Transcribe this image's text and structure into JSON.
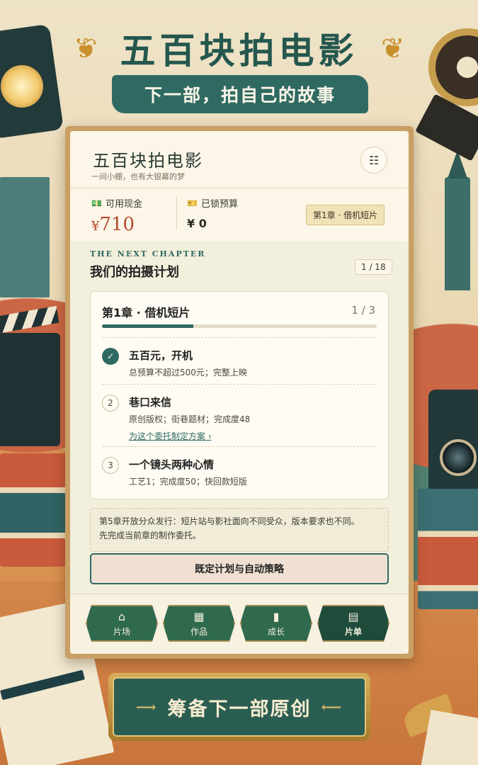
{
  "header": {
    "title": "五百块拍电影",
    "banner": "下一部，拍自己的故事"
  },
  "app": {
    "title": "五百块拍电影",
    "subtitle": "一间小棚，也有大银幕的梦",
    "menu_icon": "grid-menu-icon"
  },
  "stats": {
    "cash_label": "可用现金",
    "cash_currency": "¥",
    "cash_value": "710",
    "locked_label": "已锁预算",
    "locked_value": "¥ 0",
    "chapter_tag": "第1章 · 借机短片"
  },
  "plan": {
    "eyebrow": "THE NEXT CHAPTER",
    "title": "我们的拍摄计划",
    "page_counter": "1 / 18",
    "chapter": {
      "title": "第1章 · 借机短片",
      "progress_text": "1 / 3",
      "progress_fraction": 0.3333
    },
    "tasks": [
      {
        "marker": "✓",
        "status": "done",
        "title": "五百元，开机",
        "desc": "总预算不超过500元；完整上映"
      },
      {
        "marker": "2",
        "status": "todo",
        "title": "巷口来信",
        "desc": "原创版权；街巷题材；完成度48",
        "link": "为这个委托制定方案 ›"
      },
      {
        "marker": "3",
        "status": "todo",
        "title": "一个镜头两种心情",
        "desc": "工艺1；完成度50；快回款短版"
      }
    ],
    "notice_line1": "第5章开放分众发行：短片站与影社面向不同受众，版本要求也不同。",
    "notice_line2": "先完成当前章的制作委托。",
    "strategy_button": "既定计划与自动策略"
  },
  "nav": {
    "tabs": [
      {
        "label": "片场",
        "icon": "studio-icon",
        "active": false
      },
      {
        "label": "作品",
        "icon": "film-icon",
        "active": false
      },
      {
        "label": "成长",
        "icon": "growth-chart-icon",
        "active": false
      },
      {
        "label": "片单",
        "icon": "clipboard-icon",
        "active": true
      }
    ]
  },
  "cta": {
    "label": "筹备下一部原创"
  },
  "colors": {
    "brand_green": "#2f6a62",
    "cash_red": "#b54a2e",
    "panel_bg": "#fbf6e7"
  }
}
